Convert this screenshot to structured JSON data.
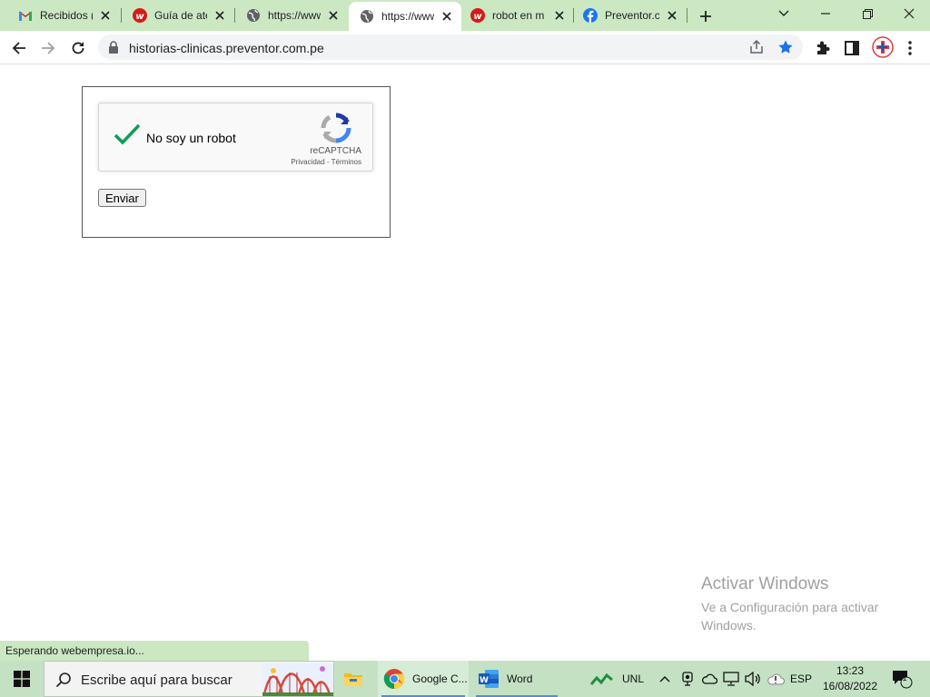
{
  "browser": {
    "tabs": [
      {
        "title": "Recibidos (1",
        "favicon": "gmail-icon",
        "active": false
      },
      {
        "title": "Guía de ate",
        "favicon": "webempresa-icon",
        "active": false
      },
      {
        "title": "https://www",
        "favicon": "globe-icon",
        "active": false
      },
      {
        "title": "https://www",
        "favicon": "globe-icon",
        "active": true
      },
      {
        "title": "robot en m",
        "favicon": "webempresa-icon",
        "active": false
      },
      {
        "title": "Preventor.c",
        "favicon": "facebook-icon",
        "active": false
      }
    ],
    "url": "historias-clinicas.preventor.com.pe",
    "bookmarked": true
  },
  "page": {
    "recaptcha": {
      "label": "No soy un robot",
      "checked": true,
      "brand": "reCAPTCHA",
      "links": "Privacidad - Términos"
    },
    "submit_label": "Enviar"
  },
  "status_text": "Esperando webempresa.io...",
  "watermark": {
    "title": "Activar Windows",
    "subtitle": "Ve a Configuración para activar Windows."
  },
  "taskbar": {
    "search_placeholder": "Escribe aquí para buscar",
    "apps": [
      {
        "label": "",
        "icon": "file-explorer-icon"
      },
      {
        "label": "Google C...",
        "icon": "chrome-icon"
      },
      {
        "label": "Word",
        "icon": "word-icon"
      }
    ],
    "tray": {
      "stock_label": "UNL",
      "language": "ESP",
      "time": "13:23",
      "date": "16/08/2022",
      "notification_count": "1"
    }
  },
  "colors": {
    "chrome_frame": "#cbe8c2",
    "taskbar": "#c4e1c4",
    "check_green": "#0f9d58",
    "star_blue": "#1a73e8"
  }
}
